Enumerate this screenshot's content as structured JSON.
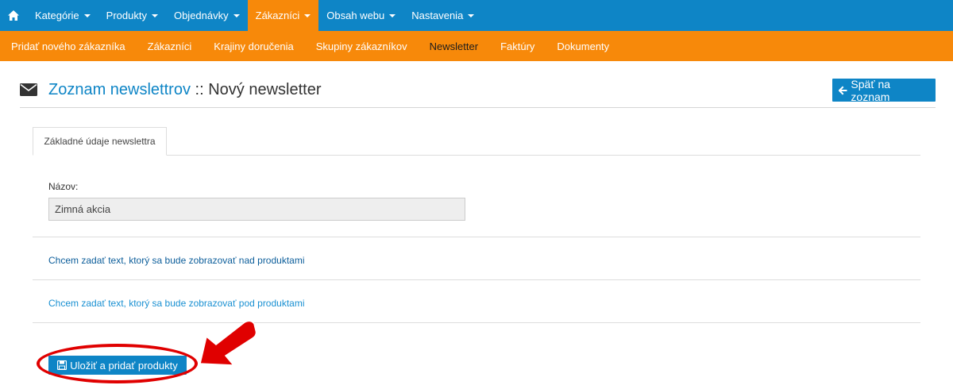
{
  "topnav": {
    "home_icon": "home-icon",
    "items": [
      {
        "label": "Kategórie"
      },
      {
        "label": "Produkty"
      },
      {
        "label": "Objednávky"
      },
      {
        "label": "Zákazníci"
      },
      {
        "label": "Obsah webu"
      },
      {
        "label": "Nastavenia"
      }
    ],
    "active_index": 3
  },
  "subnav": {
    "items": [
      {
        "label": "Pridať nového zákazníka"
      },
      {
        "label": "Zákazníci"
      },
      {
        "label": "Krajiny doručenia"
      },
      {
        "label": "Skupiny zákazníkov"
      },
      {
        "label": "Newsletter"
      },
      {
        "label": "Faktúry"
      },
      {
        "label": "Dokumenty"
      }
    ],
    "active_index": 4
  },
  "page": {
    "icon": "envelope-icon",
    "title_link": "Zoznam newslettrov",
    "title_sep": " :: ",
    "title_rest": "Nový newsletter",
    "back_button": "Späť na zoznam"
  },
  "tabs": [
    {
      "label": "Základné údaje newslettra"
    }
  ],
  "form": {
    "name_label": "Názov:",
    "name_value": "Zimná akcia",
    "link_above": "Chcem zadať text, ktorý sa bude zobrazovať nad produktami",
    "link_below": "Chcem zadať text, ktorý sa bude zobrazovať pod produktami",
    "save_button": "Uložiť a pridať produkty"
  },
  "colors": {
    "primary": "#0e85c6",
    "accent": "#f7890a",
    "annotation": "#e00000"
  }
}
